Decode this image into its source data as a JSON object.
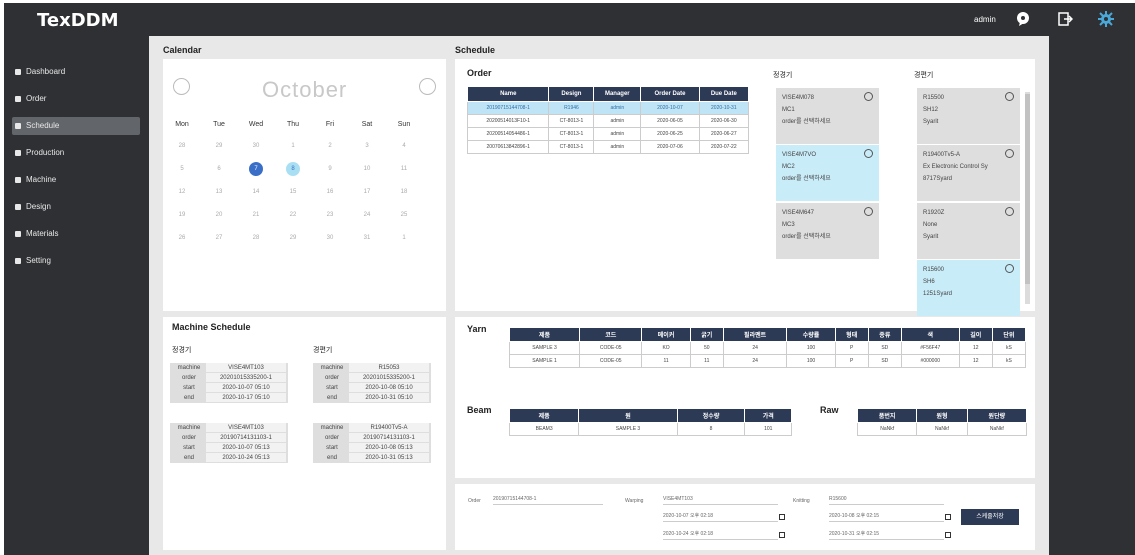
{
  "app": {
    "title": "TexDDM",
    "user": "admin"
  },
  "topbar_icons": [
    "chat-bubble-icon",
    "logout-icon",
    "settings-gear-icon"
  ],
  "sidebar": {
    "items": [
      {
        "label": "Dashboard",
        "icon": "dashboard-icon"
      },
      {
        "label": "Order",
        "icon": "order-icon"
      },
      {
        "label": "Schedule",
        "icon": "schedule-icon",
        "active": true
      },
      {
        "label": "Production",
        "icon": "production-icon"
      },
      {
        "label": "Machine",
        "icon": "machine-icon"
      },
      {
        "label": "Design",
        "icon": "design-icon"
      },
      {
        "label": "Materials",
        "icon": "materials-icon"
      },
      {
        "label": "Setting",
        "icon": "setting-icon"
      }
    ]
  },
  "calendar": {
    "title": "Calendar",
    "month": "October",
    "weekdays": [
      "Mon",
      "Tue",
      "Wed",
      "Thu",
      "Fri",
      "Sat",
      "Sun"
    ],
    "weeks": [
      [
        "28",
        "29",
        "30",
        "1",
        "2",
        "3",
        "4"
      ],
      [
        "5",
        "6",
        "7",
        "8",
        "9",
        "10",
        "11"
      ],
      [
        "12",
        "13",
        "14",
        "15",
        "16",
        "17",
        "18"
      ],
      [
        "19",
        "20",
        "21",
        "22",
        "23",
        "24",
        "25"
      ],
      [
        "26",
        "27",
        "28",
        "29",
        "30",
        "31",
        "1"
      ]
    ],
    "selected_day": "7",
    "today": "8"
  },
  "schedule": {
    "title": "Schedule"
  },
  "order": {
    "title": "Order",
    "headers": [
      "Name",
      "Design",
      "Manager",
      "Order Date",
      "Due Date"
    ],
    "rows": [
      [
        "20190715144708-1",
        "R1946",
        "admin",
        "2020-10-07",
        "2020-10-31"
      ],
      [
        "20200514013F10-1",
        "CT-8013-1",
        "admin",
        "2020-06-05",
        "2020-06-30"
      ],
      [
        "20200514054486-1",
        "CT-8013-1",
        "admin",
        "2020-06-25",
        "2020-06-27"
      ],
      [
        "20070613842896-1",
        "CT-8013-1",
        "admin",
        "2020-07-06",
        "2020-07-22"
      ]
    ],
    "selected_row": 0
  },
  "warping": {
    "title": "정경기",
    "cards": [
      {
        "id": "VISE4M078",
        "m": "MC1",
        "n": "order를 선택하세요",
        "blue": false
      },
      {
        "id": "VISE4M7VO",
        "m": "MC2",
        "n": "order를 선택하세요",
        "blue": true
      },
      {
        "id": "VISE4M647",
        "m": "MC3",
        "n": "order를 선택하세요",
        "blue": false
      }
    ]
  },
  "knitting": {
    "title": "경편기",
    "cards": [
      {
        "id": "R15500",
        "m": "SH12",
        "n": "Syarit",
        "blue": false
      },
      {
        "id": "R19400Tv5-A",
        "m": "Ex Electronic Control Sy",
        "n": "8717Syard",
        "blue": false
      },
      {
        "id": "R1920Z",
        "m": "None",
        "n": "Syarit",
        "blue": false
      },
      {
        "id": "R15600",
        "m": "SH6",
        "n": "1251Syard",
        "blue": true
      }
    ]
  },
  "machine_schedule": {
    "title": "Machine Schedule",
    "warping_title": "정경기",
    "knitting_title": "경편기",
    "warping": [
      {
        "machine": "VISE4MT103",
        "order": "20201015335200-1",
        "start": "2020-10-07 05:10",
        "end": "2020-10-17 05:10"
      },
      {
        "machine": "VISE4MT103",
        "order": "20190714131103-1",
        "start": "2020-10-07 05:13",
        "end": "2020-10-24 05:13"
      }
    ],
    "knitting": [
      {
        "machine": "R15053",
        "order": "20201015335200-1",
        "start": "2020-10-08 05:10",
        "end": "2020-10-31 05:10"
      },
      {
        "machine": "R19400Tv5-A",
        "order": "20190714131103-1",
        "start": "2020-10-08 05:13",
        "end": "2020-10-31 05:13"
      }
    ]
  },
  "yarn": {
    "title": "Yarn",
    "headers": [
      "제품",
      "코드",
      "메이커",
      "굵기",
      "필라멘트",
      "수량률",
      "형태",
      "종류",
      "색",
      "길이",
      "단위"
    ],
    "rows": [
      [
        "SAMPLE 3",
        "CODE-05",
        "KO",
        "50",
        "24",
        "100",
        "P",
        "SD",
        "#F56F47",
        "12",
        "kS"
      ],
      [
        "SAMPLE 1",
        "CODE-05",
        "11",
        "11",
        "24",
        "100",
        "P",
        "SD",
        "#000000",
        "12",
        "kS"
      ]
    ]
  },
  "beam": {
    "title": "Beam",
    "headers": [
      "제품",
      "원",
      "정수량",
      "가격"
    ],
    "rows": [
      [
        "BEAM3",
        "SAMPLE 3",
        "8",
        "101"
      ]
    ]
  },
  "raw": {
    "title": "Raw",
    "headers": [
      "품번지",
      "원형",
      "원단량"
    ],
    "rows": [
      [
        "NaNkf",
        "NaNkf",
        "NaNkf"
      ]
    ]
  },
  "form": {
    "order_label": "Order",
    "order_value": "20190715144708-1",
    "warping_label": "Warping",
    "warping_value": "VISE4MT103",
    "knitting_label": "Knitting",
    "knitting_value": "R15600",
    "w_start": "2020-10-07 오후 02:18",
    "w_end": "2020-10-24 오후 02:18",
    "k_start": "2020-10-08 오후 02:15",
    "k_end": "2020-10-31 오후 02:15",
    "button": "스케줄저장"
  }
}
